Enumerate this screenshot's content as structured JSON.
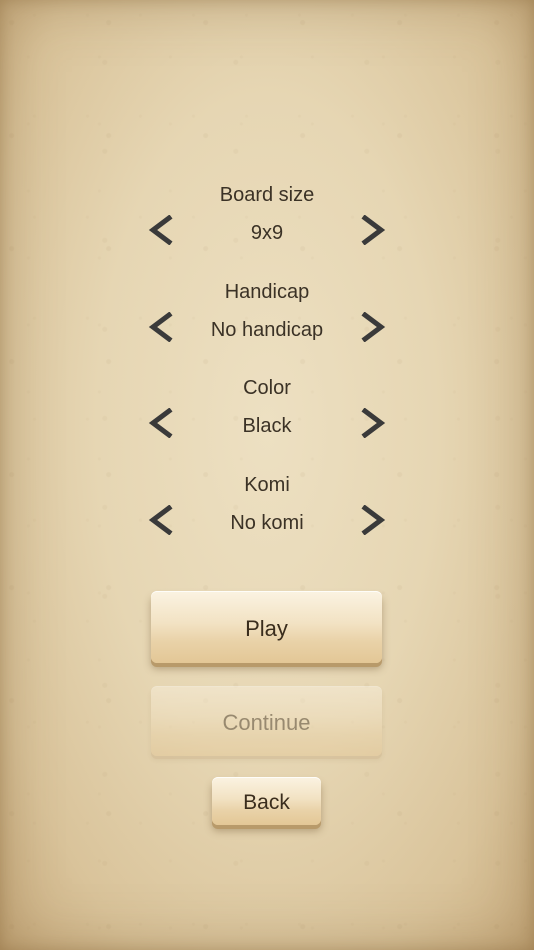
{
  "settings": [
    {
      "label": "Board size",
      "value": "9x9"
    },
    {
      "label": "Handicap",
      "value": "No handicap"
    },
    {
      "label": "Color",
      "value": "Black"
    },
    {
      "label": "Komi",
      "value": "No komi"
    }
  ],
  "buttons": {
    "play": "Play",
    "continue": "Continue",
    "back": "Back"
  },
  "colors": {
    "text": "#3b3226",
    "arrow": "#3a3a3a",
    "paper": "#e6d6b3"
  },
  "icons": {
    "prev": "chevron-left-icon",
    "next": "chevron-right-icon"
  }
}
